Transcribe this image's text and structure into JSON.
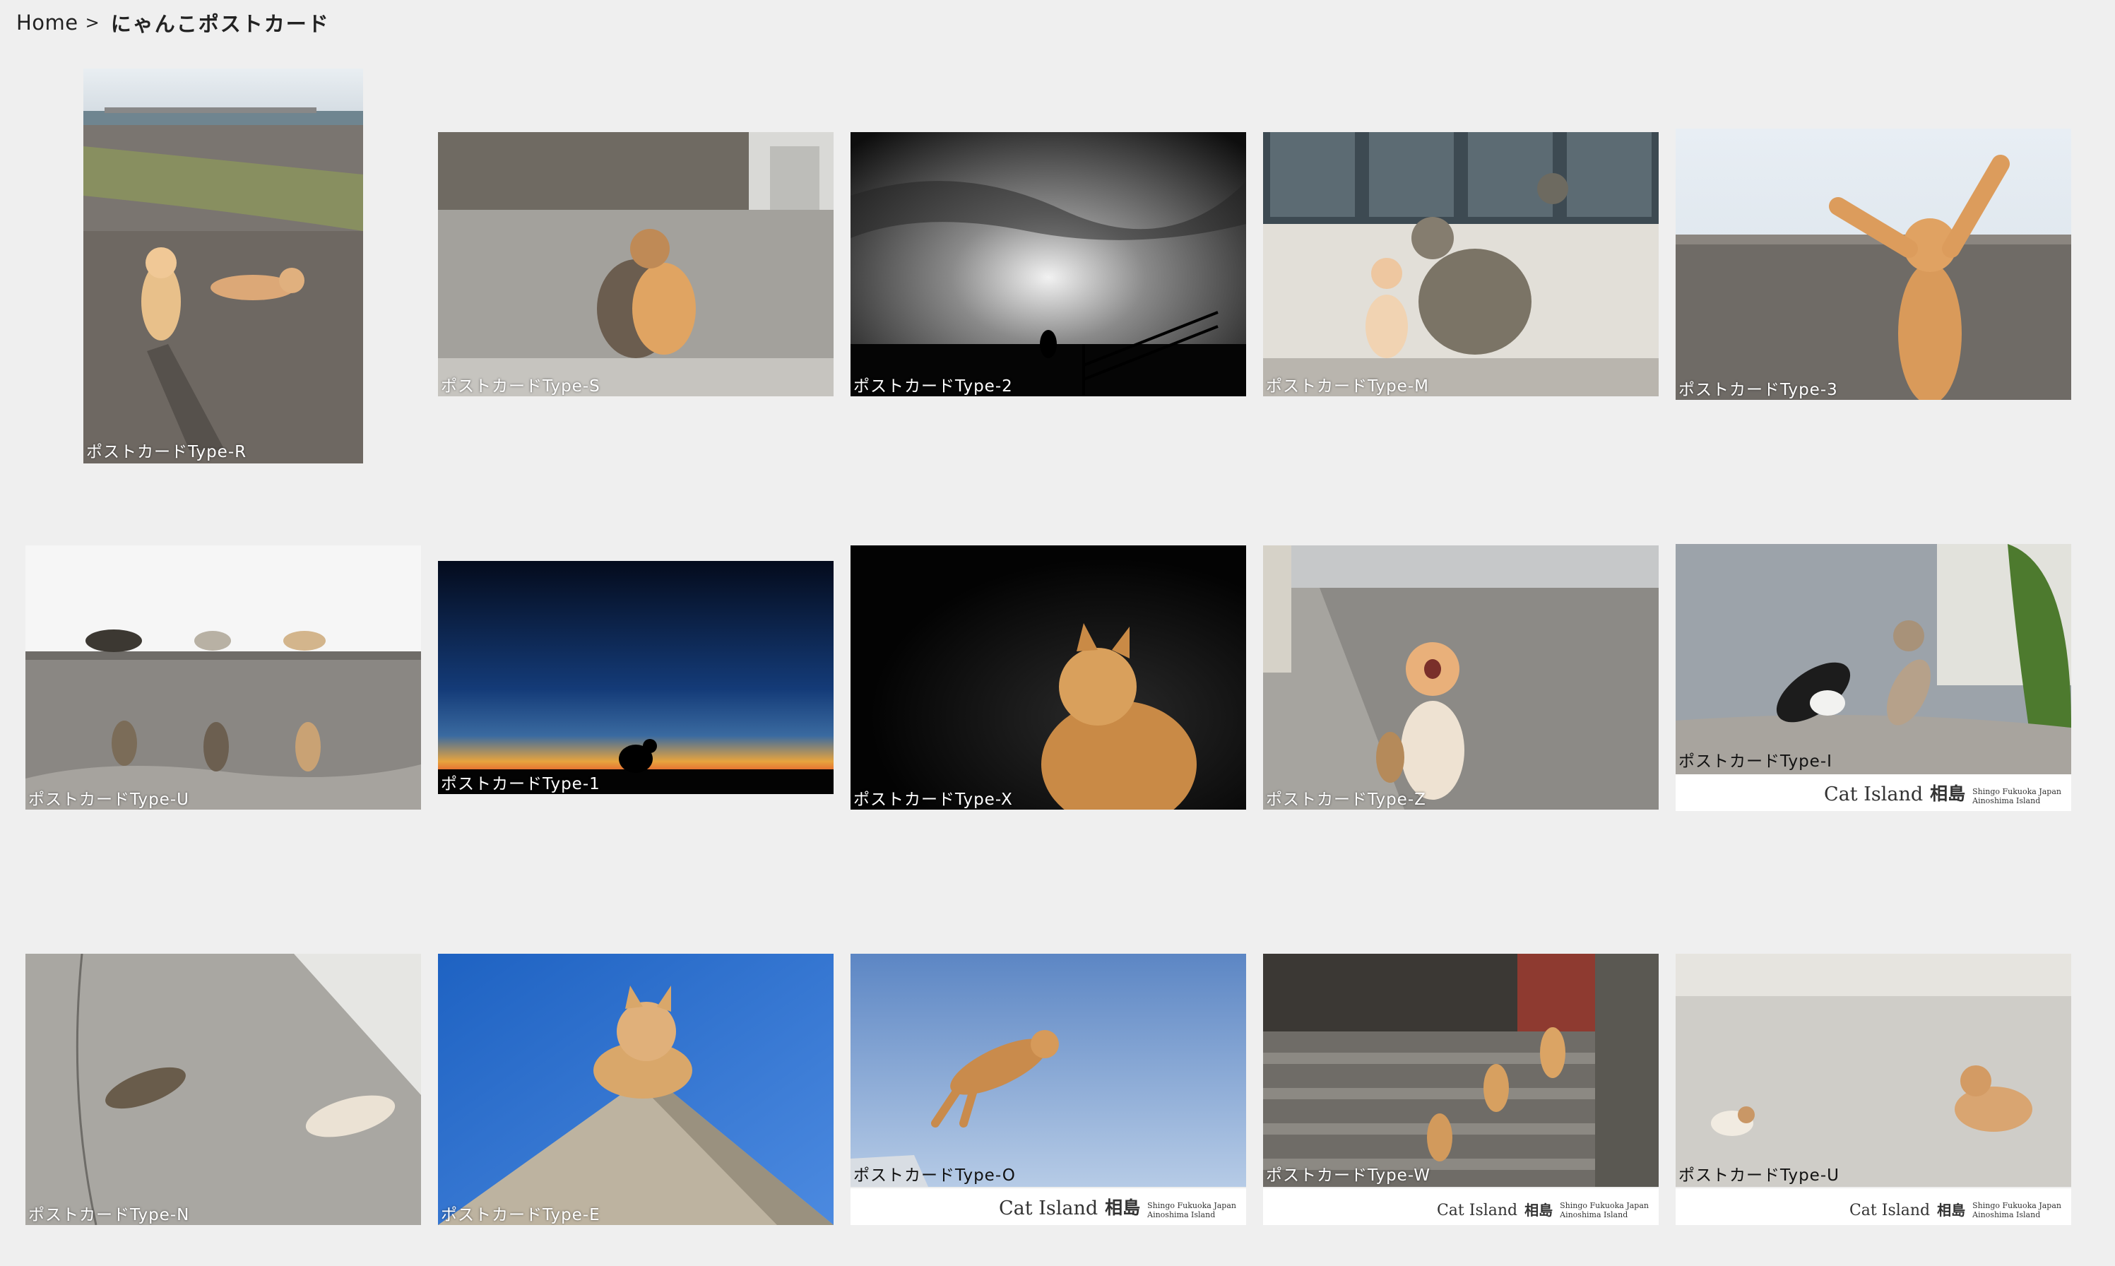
{
  "breadcrumb": {
    "home": "Home",
    "separator": ">",
    "current": "にゃんこポストカード"
  },
  "brand": {
    "name": "Cat Island",
    "kanji": "相島",
    "sub_line1": "Shingo Fukuoka Japan",
    "sub_line2": "Ainoshima Island"
  },
  "cards": [
    {
      "id": "r",
      "label": "ポストカードType-R"
    },
    {
      "id": "s",
      "label": "ポストカードType-S"
    },
    {
      "id": "2",
      "label": "ポストカードType-2"
    },
    {
      "id": "m",
      "label": "ポストカードType-M"
    },
    {
      "id": "3",
      "label": "ポストカードType-3"
    },
    {
      "id": "u1",
      "label": "ポストカードType-U"
    },
    {
      "id": "1",
      "label": "ポストカードType-1"
    },
    {
      "id": "x",
      "label": "ポストカードType-X"
    },
    {
      "id": "z",
      "label": "ポストカードType-Z"
    },
    {
      "id": "i",
      "label": "ポストカードType-I"
    },
    {
      "id": "n",
      "label": "ポストカードType-N"
    },
    {
      "id": "e",
      "label": "ポストカードType-E"
    },
    {
      "id": "o",
      "label": "ポストカードType-O"
    },
    {
      "id": "w",
      "label": "ポストカードType-W"
    },
    {
      "id": "u2",
      "label": "ポストカードType-U"
    }
  ],
  "colors": {
    "background": "#efefef",
    "label_text": "#ffffff"
  }
}
